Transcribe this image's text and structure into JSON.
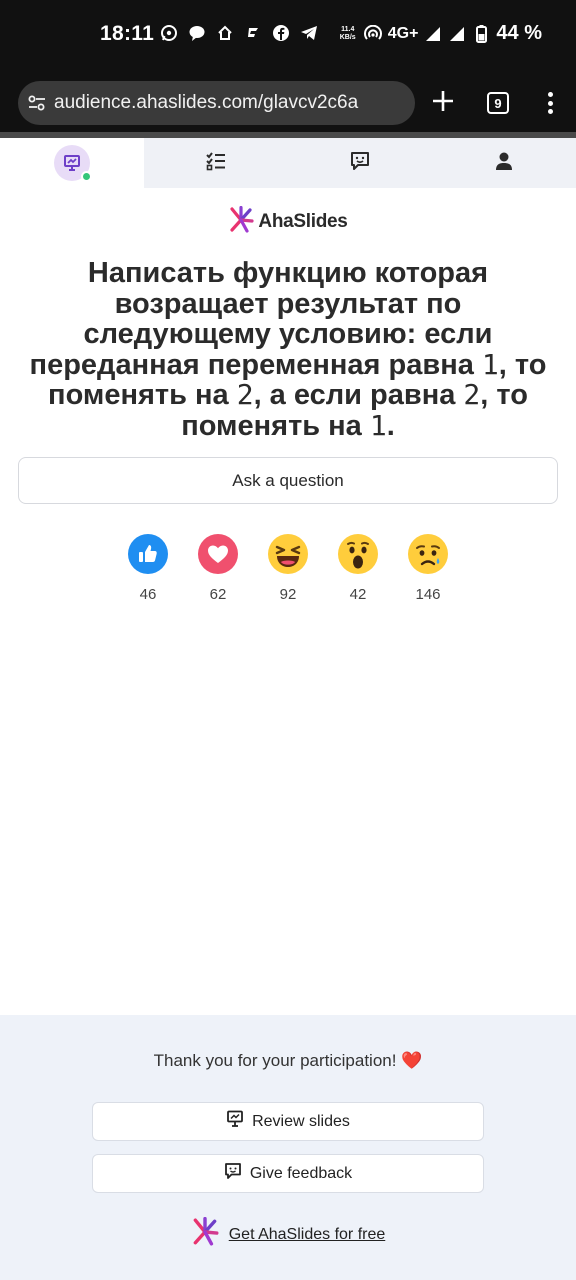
{
  "status_bar": {
    "time": "18:11",
    "network_speed_value": "11.4",
    "network_speed_unit": "KB/s",
    "network_type": "4G+",
    "battery_percent": "44 %",
    "notification_icons": [
      "whatsapp-icon",
      "chat-bubble-icon",
      "home-icon",
      "flag-icon",
      "facebook-icon",
      "telegram-icon"
    ]
  },
  "browser": {
    "url": "audience.ahaslides.com/glavcv2c6a",
    "tab_count": "9"
  },
  "app_nav": {
    "tabs": [
      {
        "name": "presentation",
        "icon": "presentation-icon",
        "active": true
      },
      {
        "name": "checklist",
        "icon": "checklist-icon",
        "active": false
      },
      {
        "name": "feedback",
        "icon": "feedback-icon",
        "active": false
      },
      {
        "name": "profile",
        "icon": "user-icon",
        "active": false
      }
    ]
  },
  "brand": {
    "name": "AhaSlides"
  },
  "question": {
    "part1": "Написать функцию которая возращает результат по следующему условию: если переданная переменная равна ",
    "code1": "1",
    "part2": ", то поменять на ",
    "code2": "2",
    "part3": ", а если равна ",
    "code3": "2",
    "part4": ", то поменять на ",
    "code4": "1",
    "part5": "."
  },
  "ask_button": {
    "label": "Ask a question"
  },
  "reactions": [
    {
      "icon": "thumbs-up-icon",
      "count": "46",
      "color": "#1f8ef1"
    },
    {
      "icon": "heart-icon",
      "count": "62",
      "color": "#f0506e"
    },
    {
      "icon": "laughing-icon",
      "count": "92",
      "color": "#ffcd3c"
    },
    {
      "icon": "surprised-icon",
      "count": "42",
      "color": "#ffcd3c"
    },
    {
      "icon": "sad-icon",
      "count": "146",
      "color": "#ffcd3c"
    }
  ],
  "footer": {
    "thanks_text": "Thank you for your participation!",
    "thanks_emoji": "❤️",
    "review_label": "Review slides",
    "feedback_label": "Give feedback",
    "get_link_label": "Get AhaSlides for free"
  },
  "colors": {
    "accent_purple": "#6e3fc8",
    "brand_pink": "#e8336f",
    "footer_bg": "#eef2f9",
    "nav_bg": "#eff1f6"
  }
}
